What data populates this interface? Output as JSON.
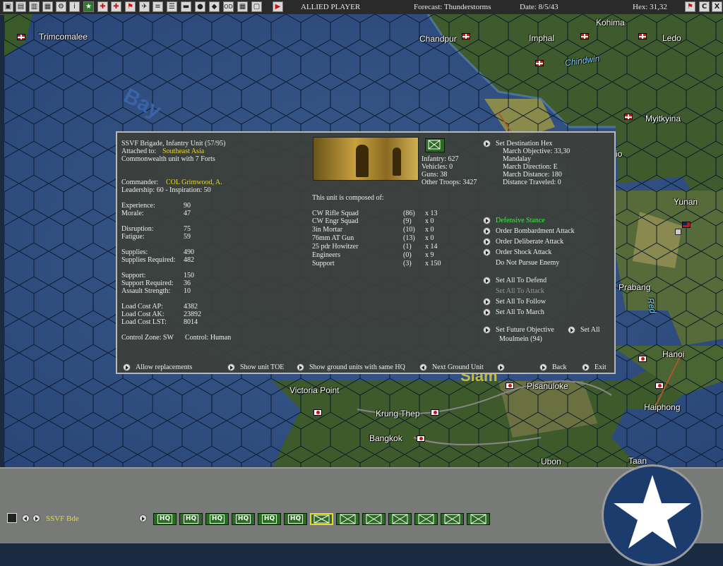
{
  "topbar": {
    "player": "ALLIED PLAYER",
    "forecast": "Forecast: Thunderstorms",
    "date": "Date: 8/5/43",
    "hex": "Hex: 31,32",
    "toolbar_icons": [
      "save-icon",
      "aircraft-icon",
      "reports-icon",
      "info-icon",
      "star-icon",
      "air-unit-icon",
      "ship-icon",
      "flag-icon",
      "plane-icon",
      "settings-icon",
      "list-icon",
      "globe-icon",
      "hq-icon",
      "od-icon",
      "table-icon",
      "screen-icon",
      "play-icon"
    ],
    "right_icons": [
      "exit-icon",
      "c-icon",
      "x-icon"
    ]
  },
  "map": {
    "places": [
      "Trimcomalee",
      "Chandpur",
      "Imphal",
      "Kohima",
      "Ledo",
      "Chindwin",
      "Myitkyina",
      "Yunan",
      "Prabang",
      "Red",
      "Hanoi",
      "Haiphong",
      "Victoria Point",
      "Krung Thep",
      "Bangkok",
      "Pisanuloke",
      "Ubon",
      "Taan",
      "Bay",
      "Siam",
      "io"
    ]
  },
  "dialog": {
    "unit_name": "SSVF Brigade, Infantry Unit (57/95)",
    "attached_label": "Attached to:",
    "attached_value": "Southeast Asia",
    "unit_type": "Commonwealth unit with 7 Forts",
    "commander_label": "Commander:",
    "commander_value": "COL Grimwood, A.",
    "leadership": "Leadership: 60 - Inspiration: 50",
    "stats": [
      {
        "label": "Experience:",
        "value": "90"
      },
      {
        "label": "Morale:",
        "value": "47"
      },
      {
        "label": "Disruption:",
        "value": "75"
      },
      {
        "label": "Fatigue:",
        "value": "59"
      },
      {
        "label": "Supplies:",
        "value": "490"
      },
      {
        "label": "Supplies Required:",
        "value": "482"
      },
      {
        "label": "Support:",
        "value": "150"
      },
      {
        "label": "Support Required:",
        "value": "36"
      },
      {
        "label": "Assault Strength:",
        "value": "10"
      },
      {
        "label": "Load Cost AP:",
        "value": "4382"
      },
      {
        "label": "Load Cost AK:",
        "value": "23892"
      },
      {
        "label": "Load Cost LST:",
        "value": "8014"
      }
    ],
    "control_zone": "Control Zone: SW",
    "control": "Control: Human",
    "troops": {
      "infantry": "Infantry: 627",
      "vehicles": "Vehicles: 0",
      "guns": "Guns: 38",
      "other": "Other Troops: 3427"
    },
    "composed_of": "This unit is composed of:",
    "composition": [
      {
        "name": "CW Rifle Squad",
        "count": "(86)",
        "x": "x 13"
      },
      {
        "name": "CW Engr Squad",
        "count": "(9)",
        "x": "x 0"
      },
      {
        "name": "3in Mortar",
        "count": "(10)",
        "x": "x 0"
      },
      {
        "name": "76mm AT Gun",
        "count": "(13)",
        "x": "x 0"
      },
      {
        "name": "25 pdr Howitzer",
        "count": "(1)",
        "x": "x 14"
      },
      {
        "name": "Engineers",
        "count": "(0)",
        "x": "x 9"
      },
      {
        "name": "Support",
        "count": "(3)",
        "x": "x 150"
      }
    ],
    "destination": {
      "set_destination": "Set Destination Hex",
      "march_objective": "March Objective: 33,30",
      "march_place": "Mandalay",
      "march_direction": "March Direction: E",
      "march_distance": "March Distance: 180",
      "distance_traveled": "Distance Traveled: 0"
    },
    "orders": {
      "defensive_stance": "Defensive Stance",
      "bombardment": "Order Bombardment Attack",
      "deliberate": "Order Deliberate Attack",
      "shock": "Order Shock Attack",
      "pursue": "Do Not Pursue Enemy",
      "set_all_defend": "Set All To Defend",
      "set_all_attack": "Set All To Attack",
      "set_all_follow": "Set All To Follow",
      "set_all_march": "Set All To March",
      "future_objective": "Set Future Objective",
      "set_all": "Set All",
      "future_place": "Moulmein (94)"
    },
    "footer": {
      "replacements": "Allow replacements",
      "show_toe": "Show unit TOE",
      "show_same_hq": "Show ground units with same HQ",
      "next_unit": "Next Ground Unit",
      "back": "Back",
      "exit": "Exit"
    }
  },
  "bottom": {
    "selected_unit": "SSVF Bde",
    "unit_buttons": [
      "HQ",
      "HQ",
      "HQ",
      "HQ",
      "HQ",
      "HQ",
      "",
      "",
      "",
      "",
      "",
      "",
      ""
    ]
  },
  "colors": {
    "accent_yellow": "#e8d830",
    "stance_green": "#46e84a"
  }
}
